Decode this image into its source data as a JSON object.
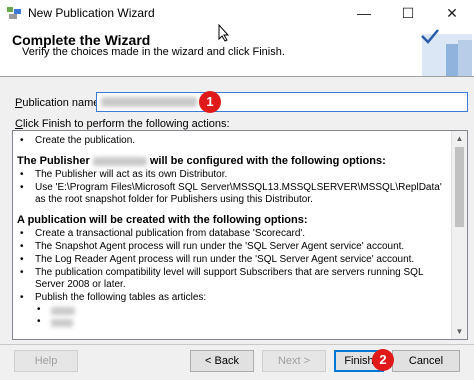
{
  "window": {
    "title": "New Publication Wizard"
  },
  "header": {
    "title": "Complete the Wizard",
    "subtitle": "Verify the choices made in the wizard and click Finish."
  },
  "form": {
    "pub_label_u": "P",
    "pub_label_rest": "ublication name:",
    "click_u": "C",
    "click_rest": "lick Finish to perform the following actions:"
  },
  "badges": {
    "one": "1",
    "two": "2"
  },
  "summary": {
    "b0": "Create the publication.",
    "s1_a": "The Publisher",
    "s1_b": "will be configured with the following options:",
    "b1": "The Publisher will act as its own Distributor.",
    "b2": "Use 'E:\\Program Files\\Microsoft SQL Server\\MSSQL13.MSSQLSERVER\\MSSQL\\ReplData' as the root snapshot folder for Publishers using this Distributor.",
    "s2": "A publication will be created with the following options:",
    "b3": "Create a transactional publication from database 'Scorecard'.",
    "b4": "The Snapshot Agent process will run under the 'SQL Server Agent service' account.",
    "b5": "The Log Reader Agent process will run under the 'SQL Server Agent service' account.",
    "b6": "The publication compatibility level will support Subscribers that are servers running SQL Server 2008 or later.",
    "b7": "Publish the following tables as articles:"
  },
  "buttons": {
    "help": "Help",
    "back": "< Back",
    "next": "Next >",
    "finish": "Finish",
    "cancel": "Cancel"
  },
  "window_controls": {
    "minimize": "—",
    "maximize": "☐",
    "close": "✕"
  }
}
